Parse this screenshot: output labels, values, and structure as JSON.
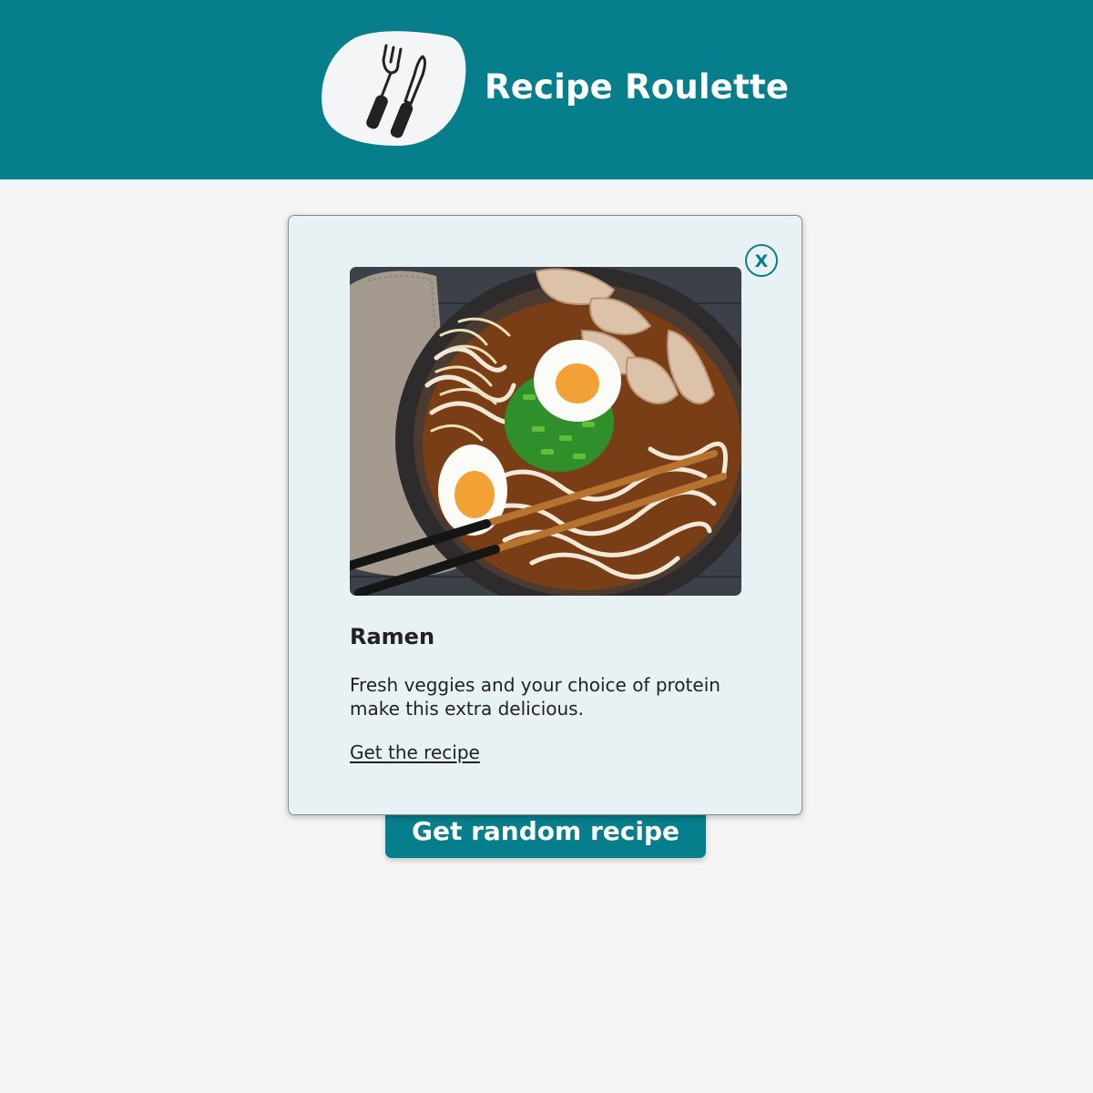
{
  "header": {
    "app_title": "Recipe Roulette",
    "logo_icon": "fork-and-knife-icon"
  },
  "main": {
    "random_button_label": "Get random recipe"
  },
  "modal": {
    "close_label": "X",
    "recipe": {
      "title": "Ramen",
      "description": "Fresh veggies and your choice of protein make this extra delicious.",
      "link_label": "Get the recipe",
      "image_subject": "ramen-bowl-photo"
    }
  },
  "colors": {
    "brand_teal": "#077e8c",
    "page_background": "#f4f4f4",
    "modal_background": "#e8f1f3",
    "text": "#222222"
  }
}
